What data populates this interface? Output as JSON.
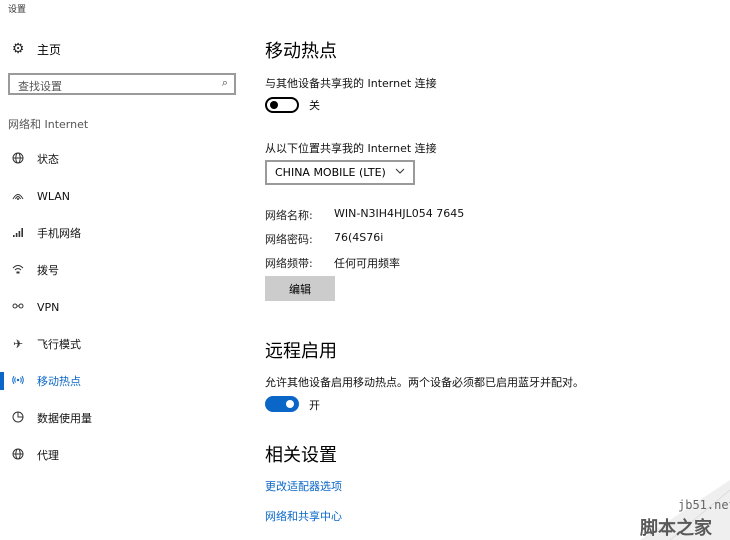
{
  "window": {
    "title": "设置"
  },
  "sidebar": {
    "home_label": "主页",
    "search_placeholder": "查找设置",
    "section_label": "网络和 Internet",
    "items": [
      {
        "label": "状态",
        "icon": "globe-icon"
      },
      {
        "label": "WLAN",
        "icon": "wifi-icon"
      },
      {
        "label": "手机网络",
        "icon": "signal-bars-icon"
      },
      {
        "label": "拨号",
        "icon": "dialup-icon"
      },
      {
        "label": "VPN",
        "icon": "vpn-icon"
      },
      {
        "label": "飞行模式",
        "icon": "airplane-icon"
      },
      {
        "label": "移动热点",
        "icon": "hotspot-icon",
        "active": true
      },
      {
        "label": "数据使用量",
        "icon": "data-usage-icon"
      },
      {
        "label": "代理",
        "icon": "globe-icon"
      }
    ]
  },
  "main": {
    "hotspot": {
      "heading": "移动热点",
      "share_desc": "与其他设备共享我的 Internet 连接",
      "toggle_state": "关",
      "share_from_label": "从以下位置共享我的 Internet 连接",
      "connection_selected": "CHINA MOBILE (LTE)",
      "network_name_key": "网络名称:",
      "network_name_val": "WIN-N3IH4HJL054 7645",
      "network_password_key": "网络密码:",
      "network_password_val": "76(4S76i",
      "network_band_key": "网络频带:",
      "network_band_val": "任何可用频率",
      "edit_button": "编辑"
    },
    "remote": {
      "heading": "远程启用",
      "desc": "允许其他设备启用移动热点。两个设备必须都已启用蓝牙并配对。",
      "toggle_state": "开"
    },
    "related": {
      "heading": "相关设置",
      "link1": "更改适配器选项",
      "link2": "网络和共享中心"
    }
  },
  "watermark": {
    "url": "jb51.net",
    "name": "脚本之家"
  },
  "colors": {
    "accent": "#0a67c8",
    "button_bg": "#cccccc"
  }
}
